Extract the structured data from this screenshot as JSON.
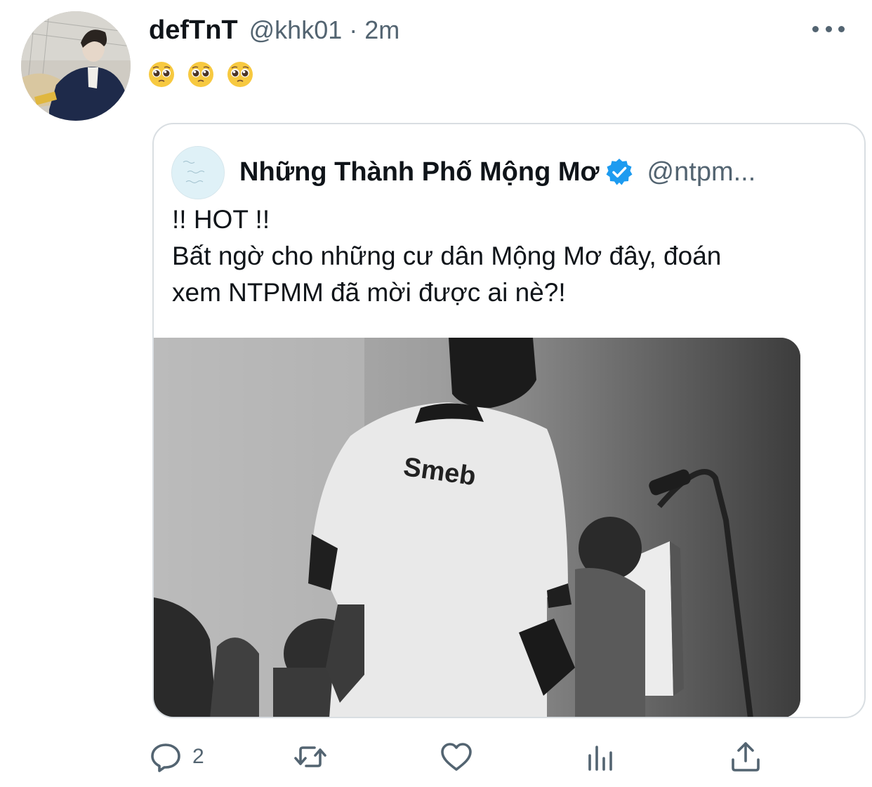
{
  "tweet": {
    "author_name": "defTnT",
    "author_handle": "@khk01",
    "separator": "·",
    "time": "2m",
    "emojis": [
      "pleading-face-emoji",
      "pleading-face-emoji",
      "pleading-face-emoji"
    ]
  },
  "quoted": {
    "author_name": "Những Thành Phố Mộng Mơ",
    "author_handle": "@ntpm...",
    "verified": true,
    "text_lines": [
      "!! HOT !!",
      "Bất ngờ cho những cư dân Mộng Mơ đây, đoán",
      "xem NTPMM đã mời được ai nè?!"
    ],
    "image_text": "Smeb"
  },
  "actions": {
    "reply_count": "2",
    "retweet_count": "",
    "like_count": "",
    "items": [
      "reply-icon",
      "retweet-icon",
      "like-icon",
      "analytics-icon",
      "share-icon"
    ]
  },
  "colors": {
    "text": "#0f1419",
    "secondary": "#536471",
    "verified": "#1d9bf0",
    "border": "#d9dee2"
  }
}
